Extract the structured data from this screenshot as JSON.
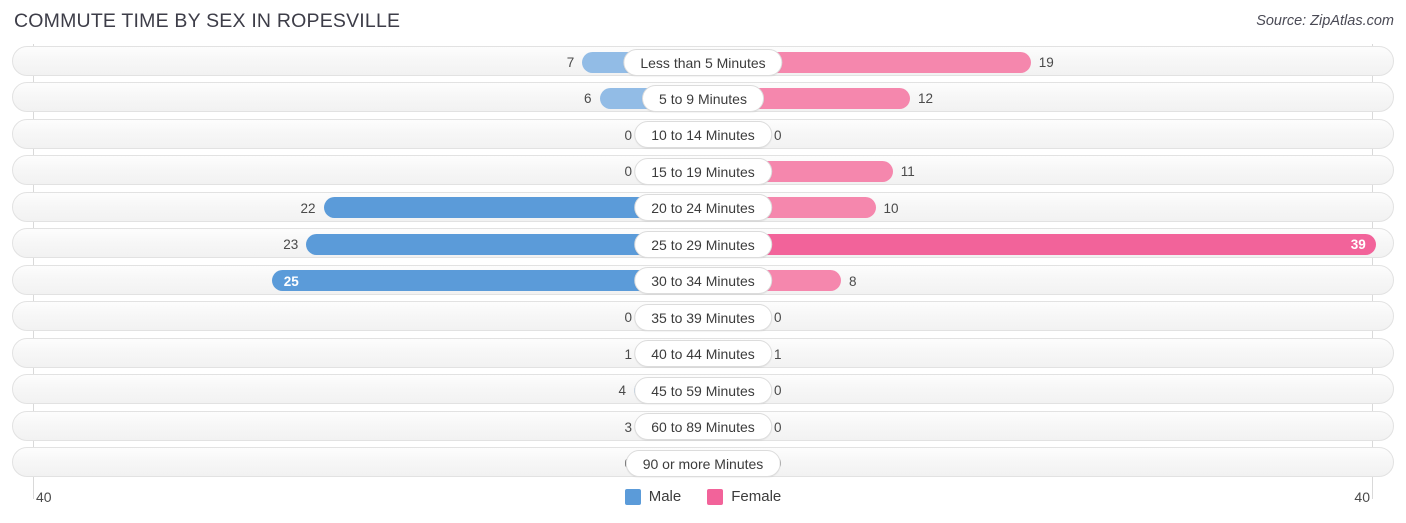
{
  "header": {
    "title": "COMMUTE TIME BY SEX IN ROPESVILLE",
    "source": "Source: ZipAtlas.com"
  },
  "legend": {
    "male_label": "Male",
    "female_label": "Female",
    "male_color": "#5b9bd9",
    "female_color": "#f2639a"
  },
  "axis": {
    "left_label": "40",
    "right_label": "40"
  },
  "chart_data": {
    "type": "bar",
    "title": "COMMUTE TIME BY SEX IN ROPESVILLE",
    "subtitle": "Source: ZipAtlas.com",
    "orientation": "horizontal-diverging",
    "xlabel": "",
    "ylabel": "",
    "xlim": [
      40,
      40
    ],
    "axis_left_max": 40,
    "axis_right_max": 40,
    "grid": true,
    "legend_position": "bottom-center",
    "categories": [
      "Less than 5 Minutes",
      "5 to 9 Minutes",
      "10 to 14 Minutes",
      "15 to 19 Minutes",
      "20 to 24 Minutes",
      "25 to 29 Minutes",
      "30 to 34 Minutes",
      "35 to 39 Minutes",
      "40 to 44 Minutes",
      "45 to 59 Minutes",
      "60 to 89 Minutes",
      "90 or more Minutes"
    ],
    "series": [
      {
        "name": "Male",
        "color": "#5b9bd9",
        "values": [
          7,
          6,
          0,
          0,
          22,
          23,
          25,
          0,
          1,
          4,
          3,
          0
        ]
      },
      {
        "name": "Female",
        "color": "#f2639a",
        "values": [
          19,
          12,
          0,
          11,
          10,
          39,
          8,
          0,
          1,
          0,
          0,
          0
        ]
      }
    ]
  },
  "rows": [
    {
      "label": "Less than 5 Minutes",
      "male": "7",
      "female": "19",
      "male_v": 7,
      "female_v": 19,
      "male_inside": false,
      "female_inside": false,
      "male_strong": false,
      "female_strong": false
    },
    {
      "label": "5 to 9 Minutes",
      "male": "6",
      "female": "12",
      "male_v": 6,
      "female_v": 12,
      "male_inside": false,
      "female_inside": false,
      "male_strong": false,
      "female_strong": false
    },
    {
      "label": "10 to 14 Minutes",
      "male": "0",
      "female": "0",
      "male_v": 0,
      "female_v": 0,
      "male_inside": false,
      "female_inside": false,
      "male_strong": false,
      "female_strong": false
    },
    {
      "label": "15 to 19 Minutes",
      "male": "0",
      "female": "11",
      "male_v": 0,
      "female_v": 11,
      "male_inside": false,
      "female_inside": false,
      "male_strong": false,
      "female_strong": false
    },
    {
      "label": "20 to 24 Minutes",
      "male": "22",
      "female": "10",
      "male_v": 22,
      "female_v": 10,
      "male_inside": false,
      "female_inside": false,
      "male_strong": true,
      "female_strong": false
    },
    {
      "label": "25 to 29 Minutes",
      "male": "23",
      "female": "39",
      "male_v": 23,
      "female_v": 39,
      "male_inside": false,
      "female_inside": true,
      "male_strong": true,
      "female_strong": true
    },
    {
      "label": "30 to 34 Minutes",
      "male": "25",
      "female": "8",
      "male_v": 25,
      "female_v": 8,
      "male_inside": true,
      "female_inside": false,
      "male_strong": true,
      "female_strong": false
    },
    {
      "label": "35 to 39 Minutes",
      "male": "0",
      "female": "0",
      "male_v": 0,
      "female_v": 0,
      "male_inside": false,
      "female_inside": false,
      "male_strong": false,
      "female_strong": false
    },
    {
      "label": "40 to 44 Minutes",
      "male": "1",
      "female": "1",
      "male_v": 1,
      "female_v": 1,
      "male_inside": false,
      "female_inside": false,
      "male_strong": false,
      "female_strong": false
    },
    {
      "label": "45 to 59 Minutes",
      "male": "4",
      "female": "0",
      "male_v": 4,
      "female_v": 0,
      "male_inside": false,
      "female_inside": false,
      "male_strong": false,
      "female_strong": false
    },
    {
      "label": "60 to 89 Minutes",
      "male": "3",
      "female": "0",
      "male_v": 3,
      "female_v": 0,
      "male_inside": false,
      "female_inside": false,
      "male_strong": false,
      "female_strong": false
    },
    {
      "label": "90 or more Minutes",
      "male": "0",
      "female": "0",
      "male_v": 0,
      "female_v": 0,
      "male_inside": false,
      "female_inside": false,
      "male_strong": false,
      "female_strong": false
    }
  ]
}
